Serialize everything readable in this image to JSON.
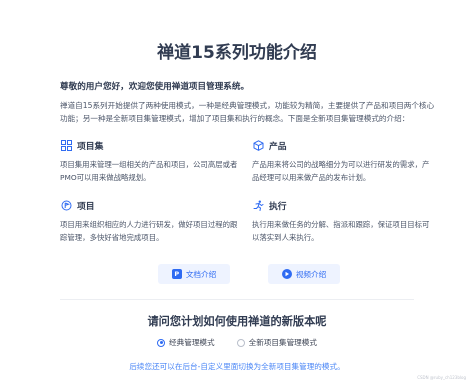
{
  "title": "禅道15系列功能介绍",
  "greeting": "尊敬的用户您好，欢迎您使用禅道项目管理系统。",
  "intro": "禅道自15系列开始提供了两种使用模式，一种是经典管理模式，功能较为精简，主要提供了产品和项目两个核心功能；另一种是全新项目集管理模式，增加了项目集和执行的概念。下面是全新项目集管理模式的介绍：",
  "cards": [
    {
      "title": "项目集",
      "desc": "项目集用来管理一组相关的产品和项目，公司高层或者PMO可以用来做战略规划。",
      "icon": "grid-icon"
    },
    {
      "title": "产品",
      "desc": "产品用来将公司的战略细分为可以进行研发的需求，产品经理可以用来做产品的发布计划。",
      "icon": "cube-icon"
    },
    {
      "title": "项目",
      "desc": "项目用来组织相应的人力进行研发，做好项目过程的跟踪管理，多快好省地完成项目。",
      "icon": "flag-icon"
    },
    {
      "title": "执行",
      "desc": "执行用来做任务的分解、指派和跟踪，保证项目目标可以落实到人来执行。",
      "icon": "run-icon"
    }
  ],
  "buttons": {
    "doc_label": "文档介绍",
    "video_label": "视频介绍"
  },
  "question": "请问您计划如何使用禅道的新版本呢",
  "options": [
    {
      "label": "经典管理模式",
      "selected": true
    },
    {
      "label": "全新项目集管理模式",
      "selected": false
    }
  ],
  "hint": "后续您还可以在后台-自定义里面切换为全新项目集管理的模式。",
  "watermark": "CSDN @ruby_ch123blog",
  "colors": {
    "accent": "#2f6bf2",
    "title": "#313c52",
    "hint": "#4a86f6"
  }
}
